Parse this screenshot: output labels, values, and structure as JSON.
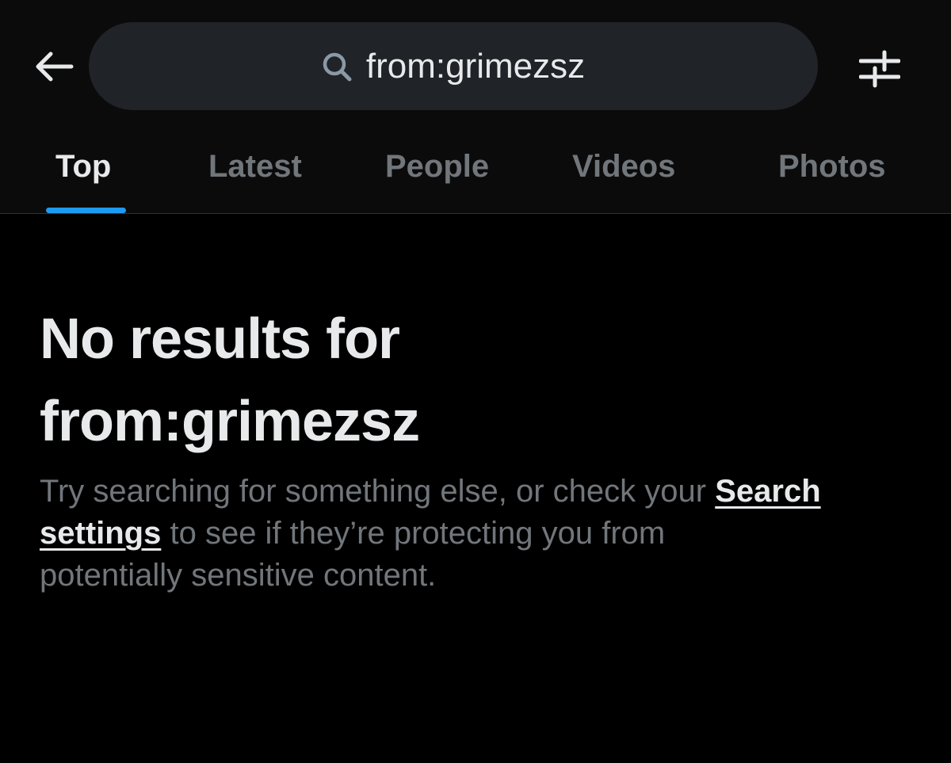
{
  "header": {
    "back_icon": "arrow-left-icon",
    "search": {
      "icon": "search-icon",
      "query": "from:grimezsz"
    },
    "filter_icon": "sliders-icon"
  },
  "tabs": [
    {
      "label": "Top",
      "active": true
    },
    {
      "label": "Latest",
      "active": false
    },
    {
      "label": "People",
      "active": false
    },
    {
      "label": "Videos",
      "active": false
    },
    {
      "label": "Photos",
      "active": false
    }
  ],
  "empty_state": {
    "title_line1": "No results for",
    "title_line2": "from:grimezsz",
    "body_part1": "Try searching for something else, or check your ",
    "link_part1": "Search",
    "link_part2": "settings",
    "body_part2": " to see if they’re protecting you from",
    "body_part3": "potentially sensitive content."
  },
  "colors": {
    "background": "#000000",
    "header_background": "#0b0b0b",
    "search_pill": "#202327",
    "primary_text": "#e7e9ea",
    "secondary_text": "#71767b",
    "accent": "#1d9bf0",
    "divider": "#2f3336"
  }
}
